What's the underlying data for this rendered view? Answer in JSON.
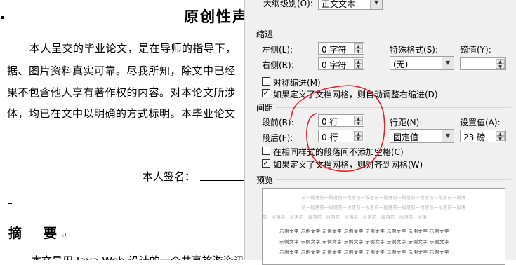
{
  "document": {
    "title": "原创性声",
    "lines": [
      "本人呈交的毕业论文，是在导师的指导下，",
      "据、图片资料真实可靠。尽我所知，除文中已经",
      "果不包含他人享有著作权的内容。对本论文所涉",
      "体，均已在文中以明确的方式标明。本毕业论文"
    ],
    "signature_label": "本人签名：",
    "abstract_heading": "摘　要",
    "paragraph_mark": "↵",
    "bottom_line": "本文是用 Java Web 设计的一个共享旅游资讯"
  },
  "dialog": {
    "outline_label": "大纲级别(O):",
    "outline_value": "正文文本",
    "indent_section": "缩进",
    "left_label": "左侧(L):",
    "left_value": "0 字符",
    "right_label": "右侧(R):",
    "right_value": "0 字符",
    "special_label": "特殊格式(S):",
    "special_value": "(无)",
    "by_label": "磅值(Y):",
    "mirror_label": "对称缩进(M)",
    "mirror_checked": false,
    "auto_adjust_label": "如果定义了文档网格，则自动调整右缩进(D)",
    "auto_adjust_checked": true,
    "spacing_section": "间距",
    "before_label": "段前(B):",
    "before_value": "0 行",
    "after_label": "段后(F):",
    "after_value": "0 行",
    "line_spacing_label": "行距(N):",
    "line_spacing_value": "固定值",
    "at_label": "设置值(A):",
    "at_value": "23 磅",
    "no_space_label": "在相同样式的段落间不添加空格(C)",
    "no_space_checked": false,
    "snap_grid_label": "如果定义了文档网格，则对齐到网格(W)",
    "snap_grid_checked": true,
    "preview_section": "预览",
    "preview_prev": "前一段落前一段落前一段落前一段落前一段落前一段落前一段落前一段落前一段落",
    "preview_sample": "示例文字 示例文字 示例文字 示例文字 示例文字 示例文字 示例文字 示例文字"
  },
  "colors": {
    "annotation": "#e0202a",
    "dialog_bg": "#f0f0f0",
    "check_mark": "#000000"
  }
}
